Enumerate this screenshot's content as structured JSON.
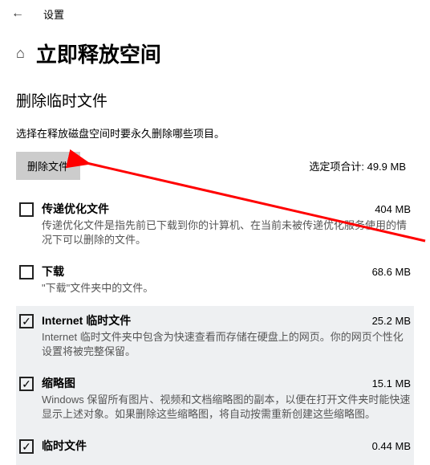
{
  "topbar": {
    "settings_label": "设置"
  },
  "title": "立即释放空间",
  "section_heading": "删除临时文件",
  "instruction": "选择在释放磁盘空间时要永久删除哪些项目。",
  "delete_btn": "删除文件",
  "total_label": "选定项合计: 49.9 MB",
  "items": [
    {
      "title": "传递优化文件",
      "size": "404 MB",
      "desc": "传递优化文件是指先前已下载到你的计算机、在当前未被传递优化服务使用的情况下可以删除的文件。",
      "checked": false
    },
    {
      "title": "下载",
      "size": "68.6 MB",
      "desc": "\"下载\"文件夹中的文件。",
      "checked": false
    },
    {
      "title": "Internet 临时文件",
      "size": "25.2 MB",
      "desc": "Internet 临时文件夹中包含为快速查看而存储在硬盘上的网页。你的网页个性化设置将被完整保留。",
      "checked": true
    },
    {
      "title": "缩略图",
      "size": "15.1 MB",
      "desc": "Windows 保留所有图片、视频和文档缩略图的副本，以便在打开文件夹时能快速显示上述对象。如果删除这些缩略图，将自动按需重新创建这些缩略图。",
      "checked": true
    },
    {
      "title": "临时文件",
      "size": "0.44 MB",
      "desc": "",
      "checked": true
    }
  ],
  "annotation": {
    "color": "#ff0000"
  }
}
